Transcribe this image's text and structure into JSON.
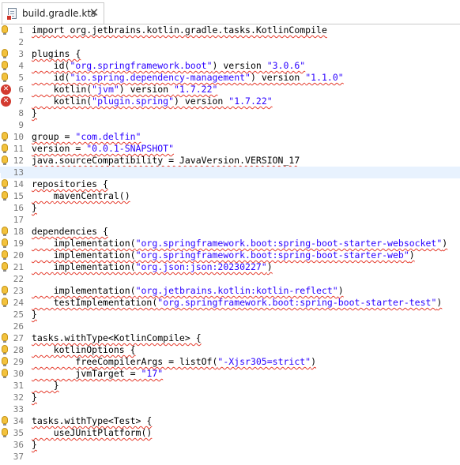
{
  "tab": {
    "filename": "build.gradle.kts",
    "close_glyph": "✕"
  },
  "lines": [
    {
      "n": "1",
      "marker": "bulb",
      "parts": [
        [
          "import org.jetbrains.kotlin.gradle.tasks.KotlinCompile",
          ""
        ]
      ]
    },
    {
      "n": "2",
      "marker": "",
      "parts": []
    },
    {
      "n": "3",
      "marker": "bulb",
      "parts": [
        [
          "plugins {",
          ""
        ]
      ]
    },
    {
      "n": "4",
      "marker": "bulb",
      "parts": [
        [
          "    id(",
          ""
        ],
        [
          "\"org.springframework.boot\"",
          "str"
        ],
        [
          ") version ",
          ""
        ],
        [
          "\"3.0.6\"",
          "str"
        ]
      ]
    },
    {
      "n": "5",
      "marker": "bulb",
      "parts": [
        [
          "    id(",
          ""
        ],
        [
          "\"io.spring.dependency-management\"",
          "str"
        ],
        [
          ") version ",
          ""
        ],
        [
          "\"1.1.0\"",
          "str"
        ]
      ]
    },
    {
      "n": "6",
      "marker": "x",
      "parts": [
        [
          "    kotlin(",
          ""
        ],
        [
          "\"jvm\"",
          "str"
        ],
        [
          ") version ",
          ""
        ],
        [
          "\"1.7.22\"",
          "str"
        ]
      ]
    },
    {
      "n": "7",
      "marker": "x",
      "parts": [
        [
          "    kotlin(",
          ""
        ],
        [
          "\"plugin.spring\"",
          "str"
        ],
        [
          ") version ",
          ""
        ],
        [
          "\"1.7.22\"",
          "str"
        ]
      ]
    },
    {
      "n": "8",
      "marker": "",
      "parts": [
        [
          "}",
          ""
        ]
      ]
    },
    {
      "n": "9",
      "marker": "",
      "parts": []
    },
    {
      "n": "10",
      "marker": "bulb",
      "parts": [
        [
          "group = ",
          ""
        ],
        [
          "\"com.delfin\"",
          "str"
        ]
      ]
    },
    {
      "n": "11",
      "marker": "bulb",
      "parts": [
        [
          "version = ",
          ""
        ],
        [
          "\"0.0.1-SNAPSHOT\"",
          "str"
        ]
      ]
    },
    {
      "n": "12",
      "marker": "bulb",
      "parts": [
        [
          "java.sourceCompatibility = JavaVersion.VERSION_17",
          ""
        ]
      ]
    },
    {
      "n": "13",
      "marker": "",
      "parts": [],
      "current": true
    },
    {
      "n": "14",
      "marker": "bulb",
      "parts": [
        [
          "repositories {",
          ""
        ]
      ]
    },
    {
      "n": "15",
      "marker": "bulb",
      "parts": [
        [
          "    mavenCentral()",
          ""
        ]
      ]
    },
    {
      "n": "16",
      "marker": "",
      "parts": [
        [
          "}",
          ""
        ]
      ]
    },
    {
      "n": "17",
      "marker": "",
      "parts": []
    },
    {
      "n": "18",
      "marker": "bulb",
      "parts": [
        [
          "dependencies {",
          ""
        ]
      ]
    },
    {
      "n": "19",
      "marker": "bulb",
      "parts": [
        [
          "    implementation(",
          ""
        ],
        [
          "\"org.springframework.boot:spring-boot-starter-websocket\"",
          "str"
        ],
        [
          ")",
          ""
        ]
      ]
    },
    {
      "n": "20",
      "marker": "bulb",
      "parts": [
        [
          "    implementation(",
          ""
        ],
        [
          "\"org.springframework.boot:spring-boot-starter-web\"",
          "str"
        ],
        [
          ")",
          ""
        ]
      ]
    },
    {
      "n": "21",
      "marker": "bulb",
      "parts": [
        [
          "    implementation(",
          ""
        ],
        [
          "\"org.json:json:20230227\"",
          "str"
        ],
        [
          ")",
          ""
        ]
      ]
    },
    {
      "n": "22",
      "marker": "",
      "parts": []
    },
    {
      "n": "23",
      "marker": "bulb",
      "parts": [
        [
          "    implementation(",
          ""
        ],
        [
          "\"org.jetbrains.kotlin:kotlin-reflect\"",
          "str"
        ],
        [
          ")",
          ""
        ]
      ]
    },
    {
      "n": "24",
      "marker": "bulb",
      "parts": [
        [
          "    testImplementation(",
          ""
        ],
        [
          "\"org.springframework.boot:spring-boot-starter-test\"",
          "str"
        ],
        [
          ")",
          ""
        ]
      ]
    },
    {
      "n": "25",
      "marker": "",
      "parts": [
        [
          "}",
          ""
        ]
      ]
    },
    {
      "n": "26",
      "marker": "",
      "parts": []
    },
    {
      "n": "27",
      "marker": "bulb",
      "parts": [
        [
          "tasks.withType<KotlinCompile> {",
          ""
        ]
      ]
    },
    {
      "n": "28",
      "marker": "bulb",
      "parts": [
        [
          "    kotlinOptions {",
          ""
        ]
      ]
    },
    {
      "n": "29",
      "marker": "bulb",
      "parts": [
        [
          "        freeCompilerArgs = listOf(",
          ""
        ],
        [
          "\"-Xjsr305=strict\"",
          "str"
        ],
        [
          ")",
          ""
        ]
      ]
    },
    {
      "n": "30",
      "marker": "bulb",
      "parts": [
        [
          "        jvmTarget = ",
          ""
        ],
        [
          "\"17\"",
          "str"
        ]
      ]
    },
    {
      "n": "31",
      "marker": "",
      "parts": [
        [
          "    }",
          ""
        ]
      ]
    },
    {
      "n": "32",
      "marker": "",
      "parts": [
        [
          "}",
          ""
        ]
      ]
    },
    {
      "n": "33",
      "marker": "",
      "parts": []
    },
    {
      "n": "34",
      "marker": "bulb",
      "parts": [
        [
          "tasks.withType<Test> {",
          ""
        ]
      ]
    },
    {
      "n": "35",
      "marker": "bulb",
      "parts": [
        [
          "    useJUnitPlatform()",
          ""
        ]
      ]
    },
    {
      "n": "36",
      "marker": "",
      "parts": [
        [
          "}",
          ""
        ]
      ]
    },
    {
      "n": "37",
      "marker": "",
      "parts": []
    }
  ]
}
